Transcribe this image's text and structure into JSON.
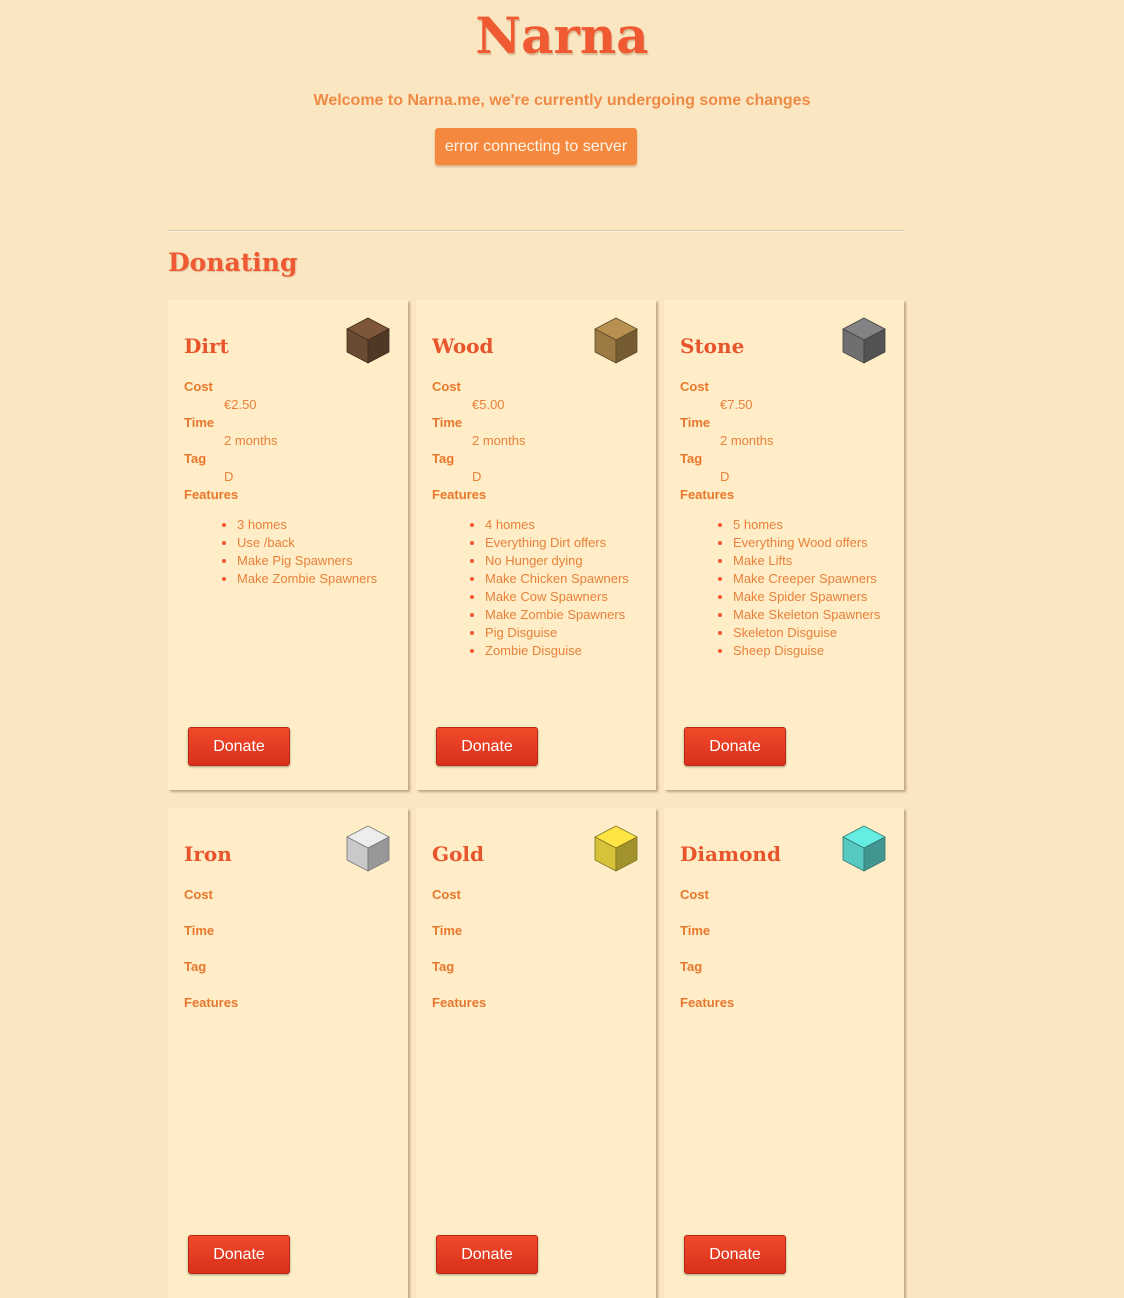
{
  "header": {
    "title": "Narna",
    "welcome": "Welcome to Narna.me, we're currently undergoing some changes",
    "status": "error connecting to server"
  },
  "donating": {
    "title": "Donating",
    "labels": {
      "cost": "Cost",
      "time": "Time",
      "tag": "Tag",
      "features": "Features"
    },
    "donate_label": "Donate",
    "ranks": [
      {
        "name": "Dirt",
        "icon": "dirt-block-icon",
        "color": "#6b4a32",
        "cost": "€2.50",
        "time": "2 months",
        "tag": "D",
        "features": [
          "3 homes",
          "Use /back",
          "Make Pig Spawners",
          "Make Zombie Spawners"
        ]
      },
      {
        "name": "Wood",
        "icon": "wood-block-icon",
        "color": "#9c7a44",
        "cost": "€5.00",
        "time": "2 months",
        "tag": "D",
        "features": [
          "4 homes",
          "Everything Dirt offers",
          "No Hunger dying",
          "Make Chicken Spawners",
          "Make Cow Spawners",
          "Make Zombie Spawners",
          "Pig Disguise",
          "Zombie Disguise"
        ]
      },
      {
        "name": "Stone",
        "icon": "stone-block-icon",
        "color": "#6f6f6f",
        "cost": "€7.50",
        "time": "2 months",
        "tag": "D",
        "features": [
          "5 homes",
          "Everything Wood offers",
          "Make Lifts",
          "Make Creeper Spawners",
          "Make Spider Spawners",
          "Make Skeleton Spawners",
          "Skeleton Disguise",
          "Sheep Disguise"
        ]
      },
      {
        "name": "Iron",
        "icon": "iron-block-icon",
        "color": "#c9c9c9",
        "cost": "",
        "time": "",
        "tag": "",
        "features": []
      },
      {
        "name": "Gold",
        "icon": "gold-block-icon",
        "color": "#d8c23a",
        "cost": "",
        "time": "",
        "tag": "",
        "features": []
      },
      {
        "name": "Diamond",
        "icon": "diamond-block-icon",
        "color": "#56c9c0",
        "cost": "",
        "time": "",
        "tag": "",
        "features": []
      }
    ]
  }
}
